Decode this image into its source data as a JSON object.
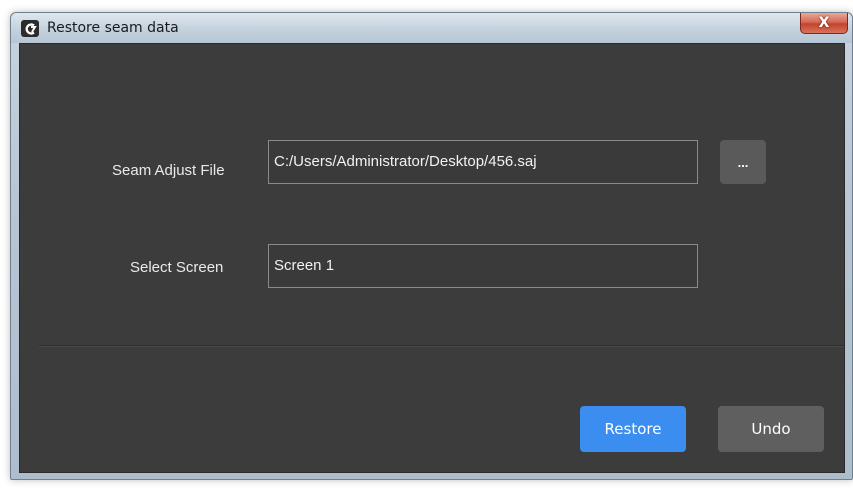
{
  "window": {
    "title": "Restore seam data",
    "close_label": "X"
  },
  "form": {
    "seam_file_label": "Seam Adjust File",
    "seam_file_value": "C:/Users/Administrator/Desktop/456.saj",
    "browse_label": "...",
    "screen_label": "Select Screen",
    "screen_value": "Screen 1"
  },
  "actions": {
    "restore_label": "Restore",
    "undo_label": "Undo"
  },
  "colors": {
    "primary": "#3b8ef0",
    "secondary": "#5f5f5f",
    "panel": "#3c3c3c"
  },
  "icons": {
    "app": "app-logo-icon",
    "close": "close-icon"
  }
}
